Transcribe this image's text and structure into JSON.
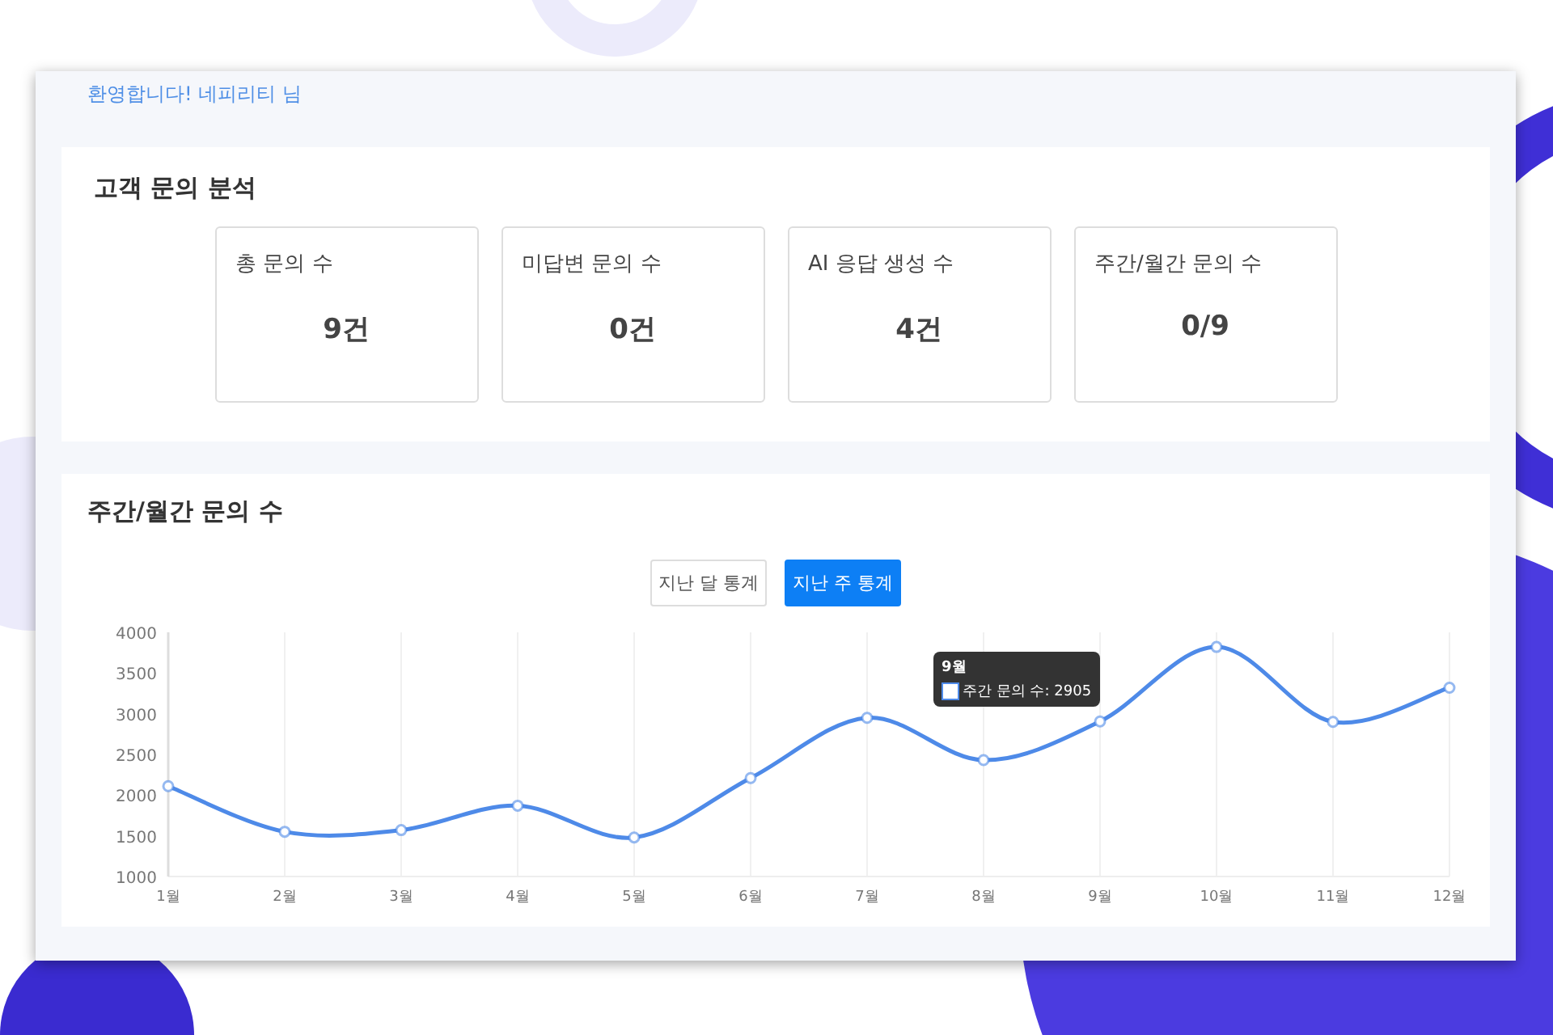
{
  "welcome": "환영합니다! 네피리티 님",
  "analysis": {
    "title": "고객 문의 분석",
    "stats": [
      {
        "label": "총 문의 수",
        "value": "9건"
      },
      {
        "label": "미답변 문의 수",
        "value": "0건"
      },
      {
        "label": "AI 응답 생성 수",
        "value": "4건"
      },
      {
        "label": "주간/월간 문의 수",
        "value": "0/9"
      }
    ]
  },
  "trend": {
    "title": "주간/월간 문의 수",
    "tabs": [
      {
        "label": "지난 달 통계",
        "selected": false
      },
      {
        "label": "지난 주 통계",
        "selected": true
      }
    ],
    "tooltip": {
      "title": "9월",
      "separator": ":",
      "value": "2905"
    },
    "chart_data": {
      "type": "line",
      "categories": [
        "1월",
        "2월",
        "3월",
        "4월",
        "5월",
        "6월",
        "7월",
        "8월",
        "9월",
        "10월",
        "11월",
        "12월"
      ],
      "series": [
        {
          "name": "주간 문의 수",
          "color": "#4e8ae8",
          "values": [
            2110,
            1550,
            1570,
            1870,
            1480,
            2210,
            2950,
            2430,
            2905,
            3820,
            2900,
            3320
          ]
        }
      ],
      "grid": true,
      "marker": true,
      "ylim": [
        1000,
        4000
      ],
      "yticks": [
        1000,
        1500,
        2000,
        2500,
        3000,
        3500,
        4000
      ]
    }
  }
}
